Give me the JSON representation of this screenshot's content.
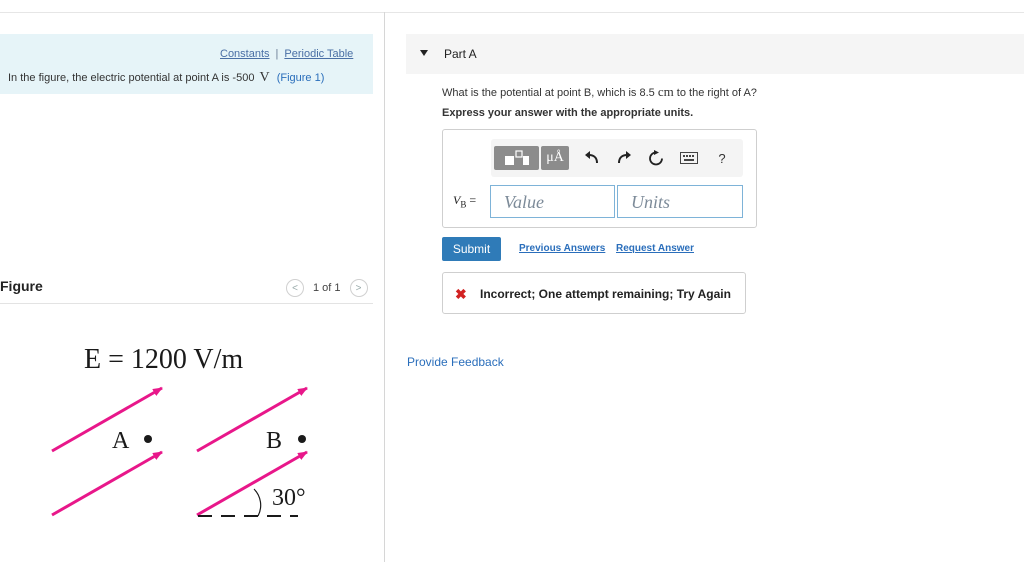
{
  "intro": {
    "constants_link": "Constants",
    "separator": "|",
    "periodic_table_link": "Periodic Table",
    "text_before": "In the figure, the electric potential at point A is -500",
    "unit": "V",
    "figure_link": "(Figure 1)"
  },
  "figure": {
    "title": "Figure",
    "pager_prev": "<",
    "pager_next": ">",
    "pager_count": "1 of 1",
    "field_label": "E = 1200 V/m",
    "point_a": "A",
    "point_b": "B",
    "angle": "30°",
    "arrow_color": "#e8178a"
  },
  "part": {
    "title": "Part A",
    "question_before": "What is the potential at point B, which is 8.5",
    "question_unit": "cm",
    "question_after": "to the right of A?",
    "instruction": "Express your answer with the appropriate units."
  },
  "answer": {
    "toolbar": {
      "units_label": "μÅ",
      "help_label": "?"
    },
    "var_symbol": "V",
    "var_subscript": "B",
    "equals": "=",
    "value_placeholder": "Value",
    "units_placeholder": "Units"
  },
  "actions": {
    "submit": "Submit",
    "previous_answers": "Previous Answers",
    "request_answer": "Request Answer"
  },
  "feedback": {
    "icon": "✖",
    "message": "Incorrect; One attempt remaining; Try Again",
    "color": "#d22222"
  },
  "provide_feedback": "Provide Feedback",
  "colors": {
    "accent": "#2f7bb8",
    "intro_bg": "#e6f4f8"
  }
}
